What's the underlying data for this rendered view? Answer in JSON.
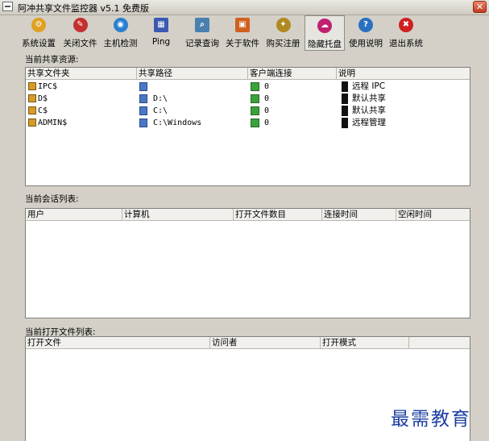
{
  "window": {
    "title": "阿冲共享文件监控器 v5.1 免费版",
    "close_glyph": "✕"
  },
  "toolbar": {
    "buttons": [
      {
        "label": "系统设置",
        "icon": "settings-icon",
        "color": "#e0a020"
      },
      {
        "label": "关闭文件",
        "icon": "close-file-icon",
        "color": "#c43030"
      },
      {
        "label": "主机检测",
        "icon": "globe-icon",
        "color": "#2a7fd0"
      },
      {
        "label": "Ping",
        "icon": "network-icon",
        "color": "#3a5ab0"
      },
      {
        "label": "记录查询",
        "icon": "log-search-icon",
        "color": "#4a80b0"
      },
      {
        "label": "关于软件",
        "icon": "about-icon",
        "color": "#d06020"
      },
      {
        "label": "购买注册",
        "icon": "register-icon",
        "color": "#b08a20"
      },
      {
        "label": "隐藏托盘",
        "icon": "tray-icon",
        "color": "#c02070"
      },
      {
        "label": "使用说明",
        "icon": "help-icon",
        "color": "#2a70c0"
      },
      {
        "label": "退出系统",
        "icon": "exit-icon",
        "color": "#d02020"
      }
    ]
  },
  "shares": {
    "section_label": "当前共享资源:",
    "columns": [
      "共享文件夹",
      "共享路径",
      "客户端连接",
      "说明"
    ],
    "rows": [
      {
        "name": "IPC$",
        "path": "",
        "clients": "0",
        "note": "远程 IPC"
      },
      {
        "name": "D$",
        "path": "D:\\",
        "clients": "0",
        "note": "默认共享"
      },
      {
        "name": "C$",
        "path": "C:\\",
        "clients": "0",
        "note": "默认共享"
      },
      {
        "name": "ADMIN$",
        "path": "C:\\Windows",
        "clients": "0",
        "note": "远程管理"
      }
    ]
  },
  "sessions": {
    "section_label": "当前会话列表:",
    "columns": [
      "用户",
      "计算机",
      "打开文件数目",
      "连接时间",
      "空闲时间"
    ]
  },
  "open_files": {
    "section_label": "当前打开文件列表:",
    "columns": [
      "打开文件",
      "访问者",
      "打开模式"
    ]
  },
  "watermark": "最需教育"
}
